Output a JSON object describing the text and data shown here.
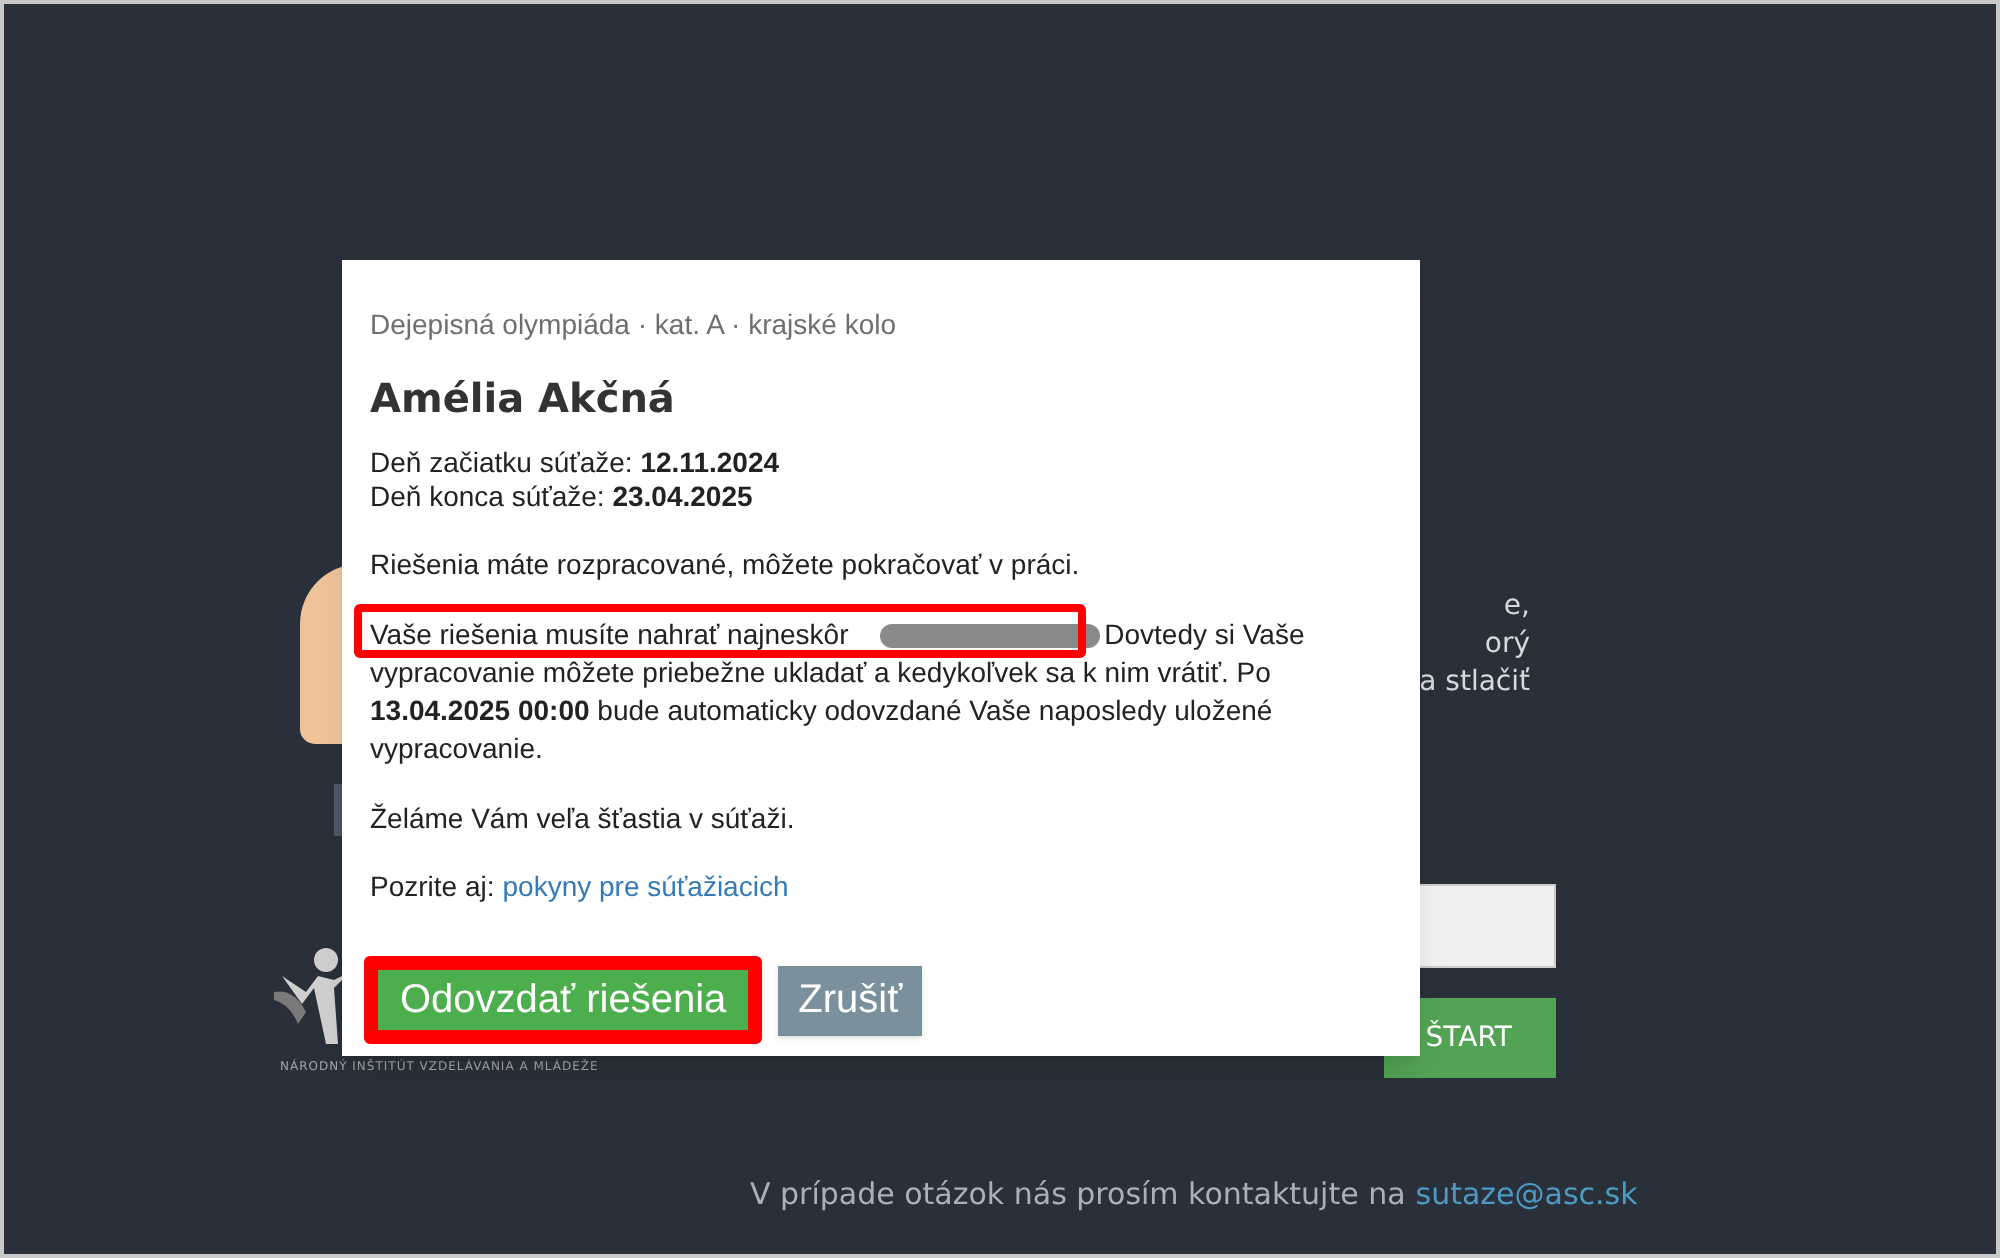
{
  "background": {
    "text_fragments": [
      "e,",
      "orý",
      "a stlačiť"
    ],
    "start_button": "ŠTART",
    "logo_caption": "NÁRODNÝ INŠTITÚT VZDELÁVANIA A MLÁDEŽE",
    "footer": {
      "text": "V prípade otázok nás prosím kontaktujte na",
      "link": "sutaze@asc.sk"
    }
  },
  "dialog": {
    "breadcrumb": "Dejepisná olympiáda · kat. A · krajské kolo",
    "title": "Amélia Akčná",
    "dates": [
      {
        "label": "Deň začiatku súťaže:",
        "value": "12.11.2024"
      },
      {
        "label": "Deň konca súťaže:",
        "value": "23.04.2025"
      }
    ],
    "status": "Riešenia máte rozpracované, môžete pokračovať v práci.",
    "deadline": {
      "before": "Vaše riešenia musíte nahrať najneskôr",
      "redacted": true,
      "after": "Dovtedy si Vaše vypracovanie môžete priebežne ukladať a kedykoľvek sa k nim vrátiť. Po **13.04.2025 00:00** bude automaticky odovzdané Vaše naposledy uložené vypracovanie.",
      "highlighted": true
    },
    "wish": "Želáme Vám veľa šťastia v súťaži.",
    "see_also": {
      "label": "Pozrite aj:",
      "link": "pokyny pre súťažiacich"
    },
    "buttons": [
      {
        "label": "Odovzdať riešenia",
        "kind": "primary",
        "highlighted": true
      },
      {
        "label": "Zrušiť",
        "kind": "secondary",
        "highlighted": false
      }
    ]
  }
}
